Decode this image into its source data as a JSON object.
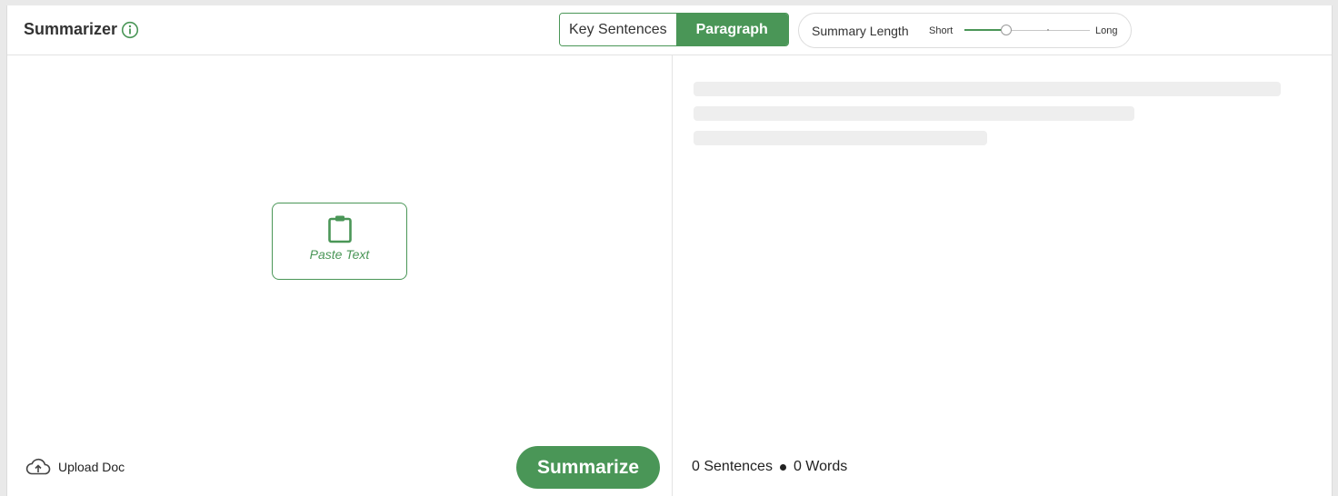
{
  "header": {
    "title": "Summarizer",
    "modes": [
      "Key Sentences",
      "Paragraph"
    ],
    "active_mode": "Paragraph",
    "summary_length": {
      "label": "Summary Length",
      "min_label": "Short",
      "max_label": "Long",
      "value_fraction": 0.33
    }
  },
  "input_panel": {
    "paste_label": "Paste Text",
    "upload_label": "Upload Doc",
    "summarize_label": "Summarize"
  },
  "output_panel": {
    "sentences_count": "0 Sentences",
    "words_count": "0 Words"
  },
  "colors": {
    "accent": "#4a9657",
    "skeleton": "#eeeeee"
  },
  "icons": {
    "info": "info-icon",
    "paste": "clipboard-icon",
    "upload": "cloud-upload-icon"
  }
}
